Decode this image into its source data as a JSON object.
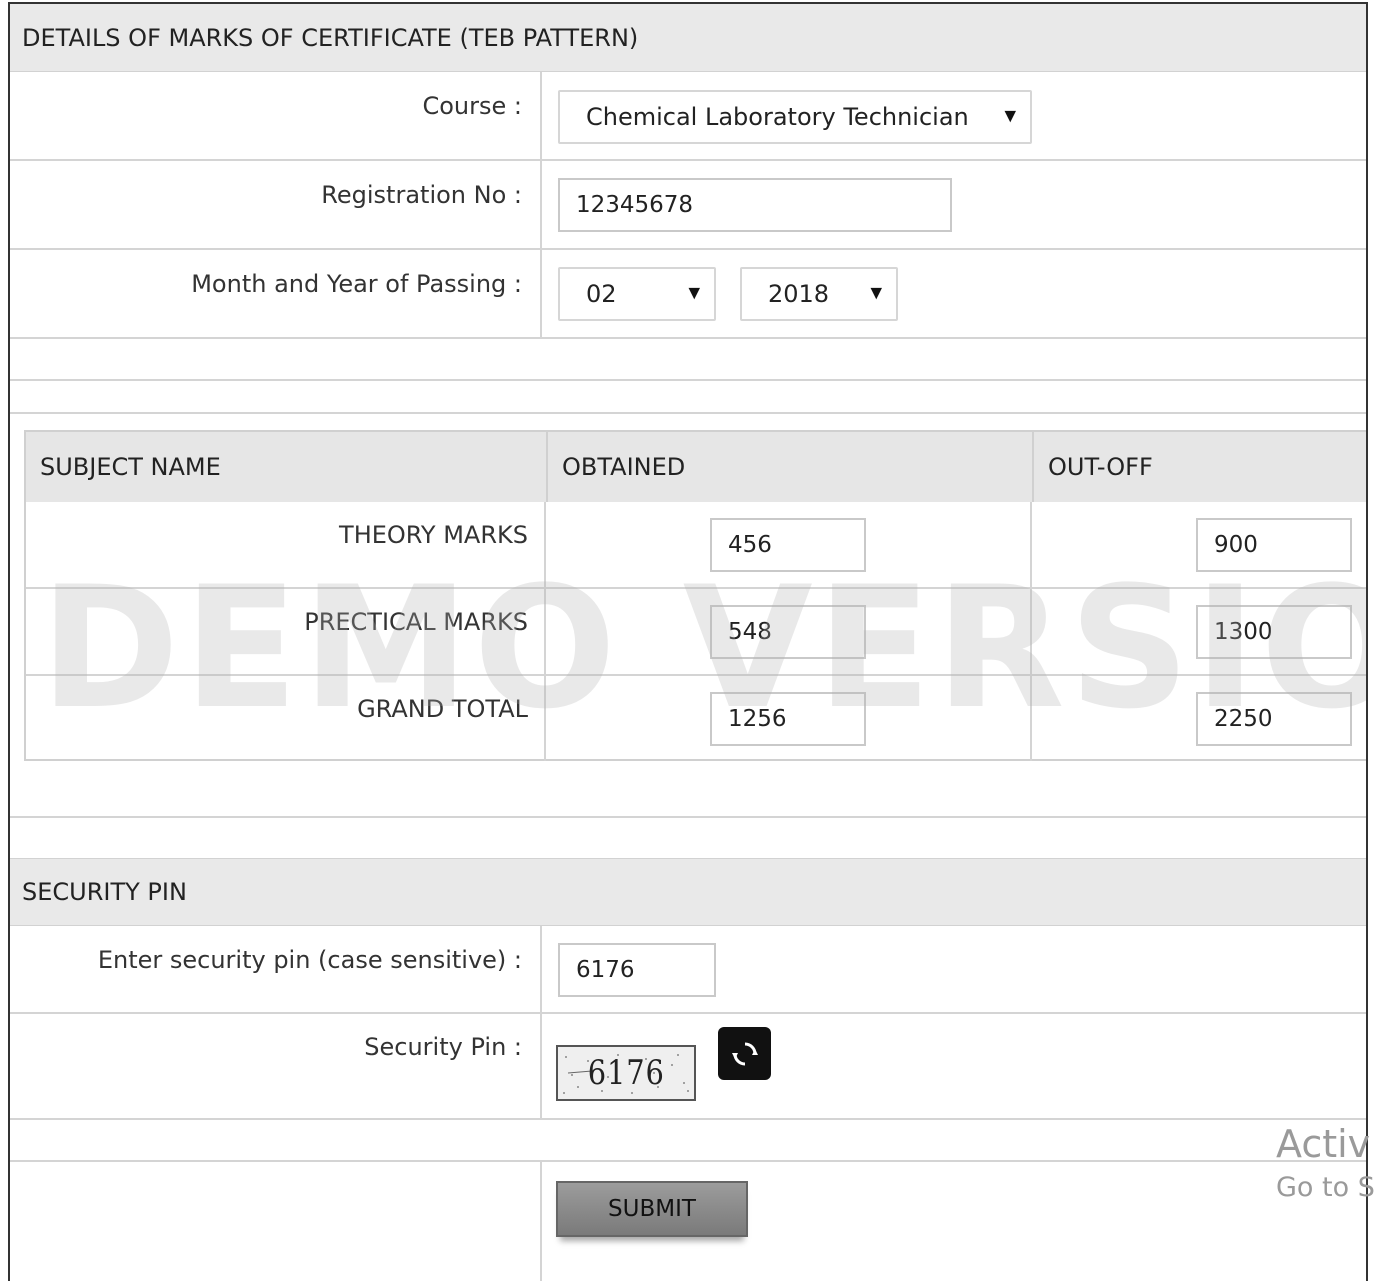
{
  "marks_section": {
    "title": "DETAILS OF MARKS OF CERTIFICATE (TEB PATTERN)",
    "course_label": "Course :",
    "course_value": "Chemical Laboratory Technician",
    "registration_label": "Registration No :",
    "registration_value": "12345678",
    "passing_label": "Month and Year of Passing :",
    "month_value": "02",
    "year_value": "2018"
  },
  "marks_table": {
    "headers": [
      "SUBJECT NAME",
      "OBTAINED",
      "OUT-OFF"
    ],
    "rows": [
      {
        "subject": "THEORY MARKS",
        "obtained": "456",
        "out_of": "900"
      },
      {
        "subject": "PRECTICAL MARKS",
        "obtained": "548",
        "out_of": "1300"
      },
      {
        "subject": "GRAND TOTAL",
        "obtained": "1256",
        "out_of": "2250"
      }
    ]
  },
  "watermark": "DEMO VERSION",
  "security_section": {
    "title": "SECURITY PIN",
    "enter_pin_label": "Enter security pin (case sensitive) :",
    "enter_pin_value": "6176",
    "pin_label": "Security Pin :",
    "captcha_text": "6176"
  },
  "submit_label": "SUBMIT",
  "windows_activation": {
    "line1": "Activ",
    "line2": "Go to S"
  },
  "icons": {
    "select_arrow": "dropdown-arrow-icon",
    "refresh": "refresh-icon"
  },
  "colors": {
    "header_bg": "#e9e9e9",
    "submit_bg": "#8a8a8a",
    "refresh_bg": "#111111"
  }
}
